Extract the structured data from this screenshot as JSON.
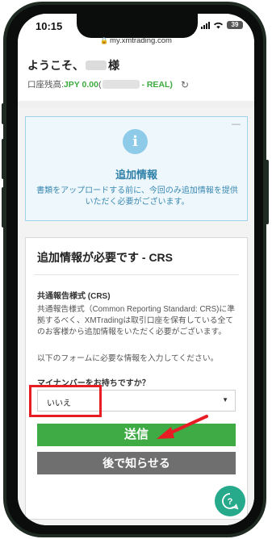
{
  "status_bar": {
    "time": "10:15",
    "battery": "39"
  },
  "browser": {
    "url": "my.xmtrading.com"
  },
  "header": {
    "welcome_prefix": "ようこそ、",
    "welcome_suffix": "様",
    "balance_label": "口座残高: ",
    "balance_currency_amount": "JPY 0.00",
    "balance_open": " (",
    "balance_type": "- REAL)"
  },
  "info": {
    "title": "追加情報",
    "description": "書類をアップロードする前に、今回のみ追加情報を提供いただく必要がございます。",
    "collapse": "—",
    "icon_glyph": "i"
  },
  "form": {
    "title": "追加情報が必要です - CRS",
    "section_title": "共通報告様式 (CRS)",
    "section_body": "共通報告様式（Common Reporting Standard: CRS)に準拠するべく、XMTradingは取引口座を保有している全てのお客様から追加情報をいただく必要がございます。",
    "section_note": "以下のフォームに必要な情報を入力してください。",
    "question": "マイナンバーをお持ちですか？",
    "select_value": "いいえ",
    "submit_label": "送信",
    "later_label": "後で知らせる"
  },
  "colors": {
    "accent_green": "#3fab45",
    "annotation_red": "#e81c24",
    "info_blue": "#2d7fa8",
    "help_teal": "#27a98c"
  }
}
